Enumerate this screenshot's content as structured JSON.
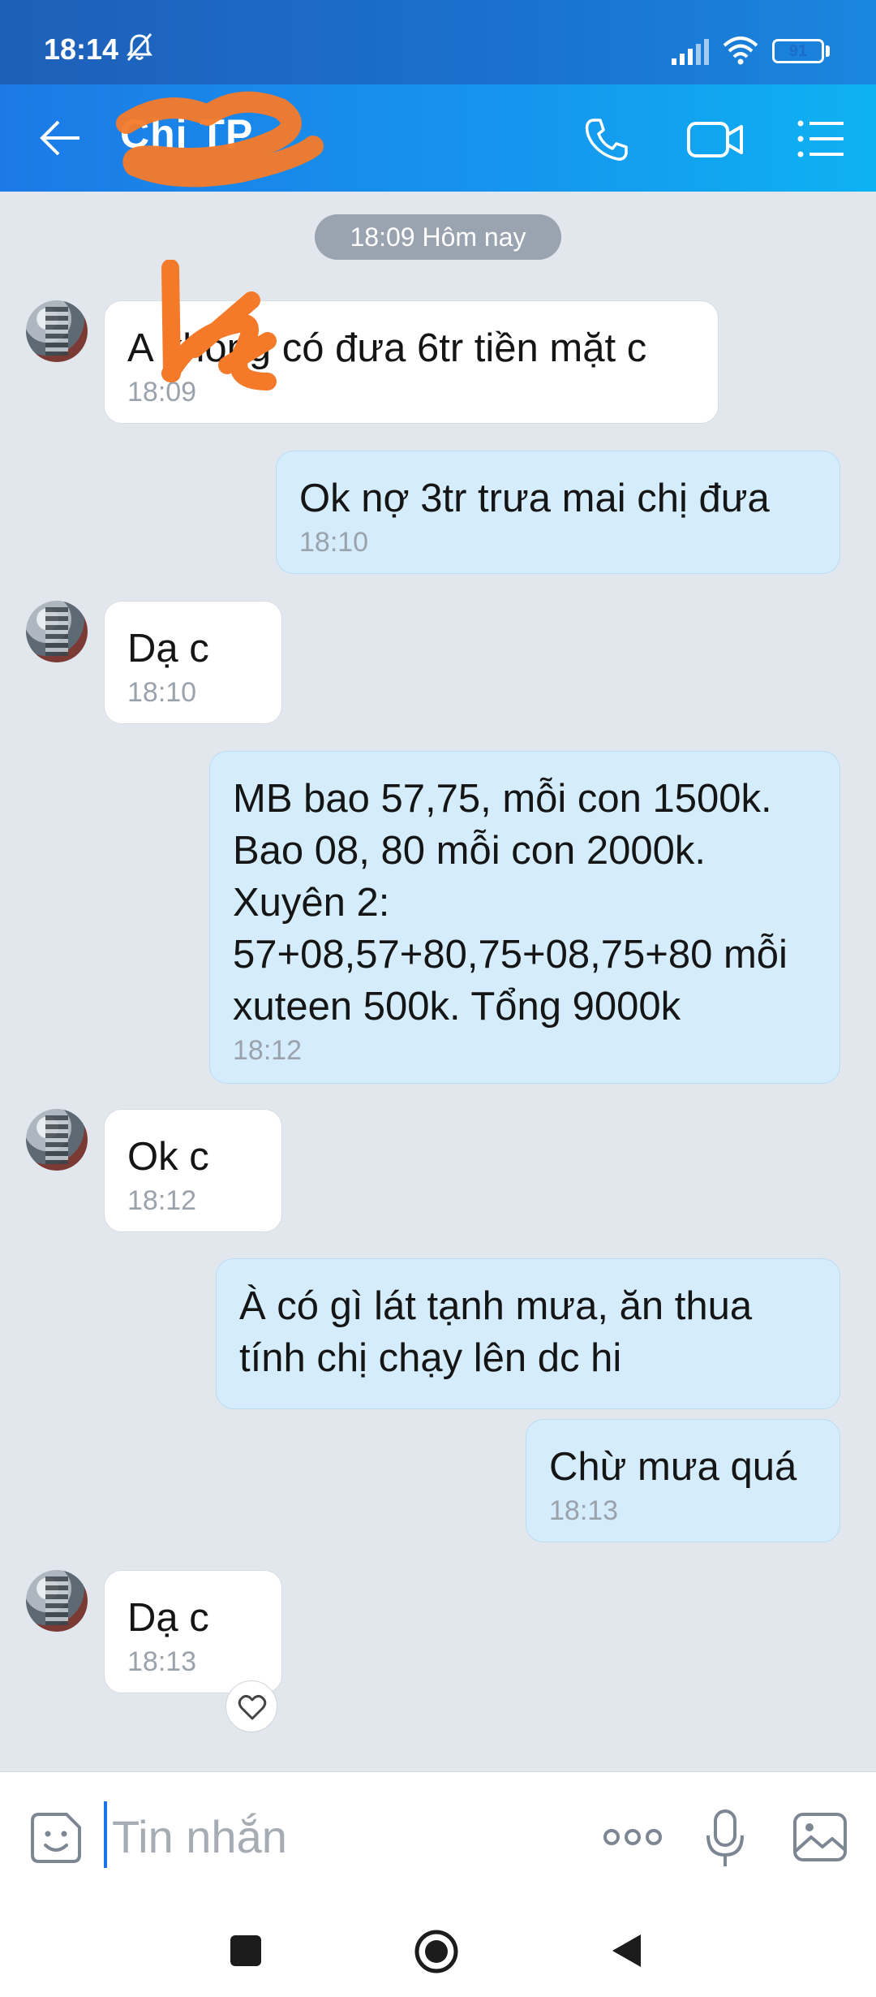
{
  "status_bar": {
    "time": "18:14",
    "battery": "91",
    "battery_level": 0.91
  },
  "header": {
    "title": "Chi TP"
  },
  "date_separator": "18:09 Hôm nay",
  "messages": [
    {
      "direction": "in",
      "text": "A không có đưa 6tr tiền mặt c",
      "time": "18:09"
    },
    {
      "direction": "out",
      "text": "Ok nợ 3tr trưa mai chị đưa",
      "time": "18:10"
    },
    {
      "direction": "in",
      "text": "Dạ c",
      "time": "18:10"
    },
    {
      "direction": "out",
      "text": "MB bao 57,75, mỗi con 1500k. Bao 08, 80 mỗi con 2000k. Xuyên 2: 57+08,57+80,75+08,75+80 mỗi xuteen 500k. Tổng 9000k",
      "time": "18:12"
    },
    {
      "direction": "in",
      "text": "Ok c",
      "time": "18:12"
    },
    {
      "direction": "out",
      "text": "À có gì lát tạnh mưa, ăn thua tính chị chạy lên dc hi",
      "time": ""
    },
    {
      "direction": "out",
      "text": "Chừ mưa quá",
      "time": "18:13"
    },
    {
      "direction": "in",
      "text": "Dạ c",
      "time": "18:13"
    }
  ],
  "input": {
    "placeholder": "Tin nhắn",
    "value": ""
  },
  "icons": {
    "back": "back-arrow-icon",
    "call": "phone-icon",
    "video": "video-camera-icon",
    "menu": "menu-list-icon",
    "sticker": "sticker-icon",
    "more": "more-dots-icon",
    "mic": "microphone-icon",
    "image": "image-icon",
    "like": "heart-icon"
  },
  "colors": {
    "header_start": "#1c7ae6",
    "header_end": "#0eb2f2",
    "outgoing_bubble": "#d4ecfb",
    "incoming_bubble": "#ffffff",
    "background": "#e2e7ee",
    "redaction": "#f47a2a"
  }
}
